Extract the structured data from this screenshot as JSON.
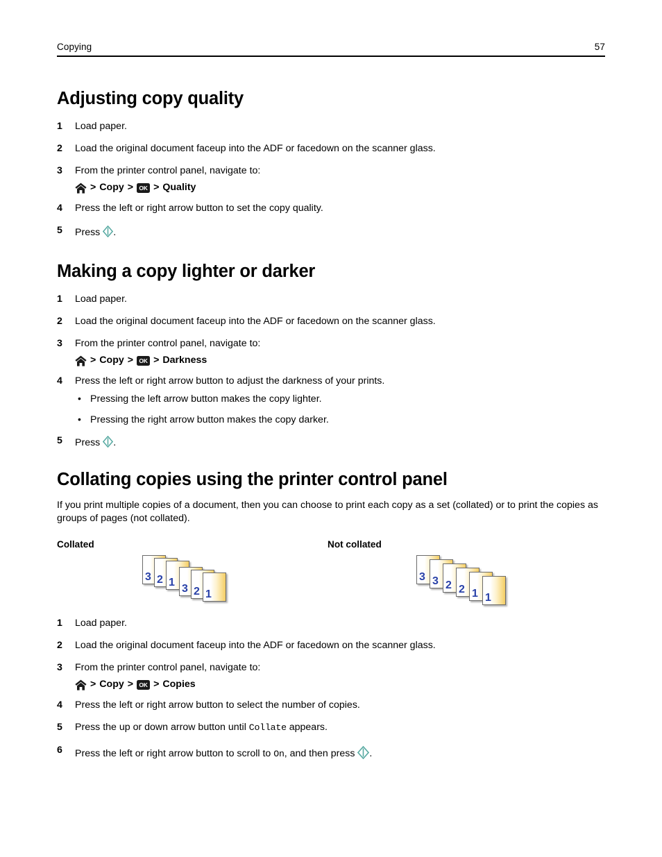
{
  "header": {
    "chapter": "Copying",
    "page_number": "57"
  },
  "icons": {
    "home": "home-icon",
    "ok": "OK",
    "start": "start-icon"
  },
  "sections": [
    {
      "id": "adjusting-copy-quality",
      "heading": "Adjusting copy quality",
      "steps": [
        {
          "num": "1",
          "text": "Load paper."
        },
        {
          "num": "2",
          "text": "Load the original document faceup into the ADF or facedown on the scanner glass."
        },
        {
          "num": "3",
          "text": "From the printer control panel, navigate to:"
        },
        {
          "num": "4",
          "text": "Press the left or right arrow button to set the copy quality."
        },
        {
          "num": "5",
          "text": "Press"
        }
      ],
      "navpath": {
        "sep1": ">",
        "copy": "Copy",
        "sep2": ">",
        "sep3": ">",
        "target": "Quality"
      }
    },
    {
      "id": "making-a-copy-lighter-or-darker",
      "heading": "Making a copy lighter or darker",
      "steps": [
        {
          "num": "1",
          "text": "Load paper."
        },
        {
          "num": "2",
          "text": "Load the original document faceup into the ADF or facedown on the scanner glass."
        },
        {
          "num": "3",
          "text": "From the printer control panel, navigate to:"
        },
        {
          "num": "4",
          "text": "Press the left or right arrow button to adjust the darkness of your prints."
        },
        {
          "num": "5",
          "text": "Press"
        }
      ],
      "navpath": {
        "sep1": ">",
        "copy": "Copy",
        "sep2": ">",
        "sep3": ">",
        "target": "Darkness"
      },
      "bullets": [
        "Pressing the left arrow button makes the copy lighter.",
        "Pressing the right arrow button makes the copy darker."
      ]
    },
    {
      "id": "collating-copies",
      "heading": "Collating copies using the printer control panel",
      "intro": "If you print multiple copies of a document, then you can choose to print each copy as a set (collated) or to print the copies as groups of pages (not collated).",
      "figure": {
        "collated_label": "Collated",
        "not_collated_label": "Not collated",
        "collated_sequence": [
          "3",
          "2",
          "1",
          "3",
          "2",
          "1"
        ],
        "not_collated_sequence": [
          "3",
          "3",
          "2",
          "2",
          "1",
          "1"
        ],
        "sheet_number_color": "#2a42a8",
        "sheet_fill_start": "#ffffff",
        "sheet_fill_end": "#f5ce63"
      },
      "steps": [
        {
          "num": "1",
          "text": "Load paper."
        },
        {
          "num": "2",
          "text": "Load the original document faceup into the ADF or facedown on the scanner glass."
        },
        {
          "num": "3",
          "text": "From the printer control panel, navigate to:"
        },
        {
          "num": "4",
          "text": "Press the left or right arrow button to select the number of copies."
        },
        {
          "num": "5a",
          "text": "Press the up or down arrow button until"
        },
        {
          "num": "5b",
          "text": "appears."
        },
        {
          "num": "6a",
          "text": "Press the left or right arrow button to scroll to"
        },
        {
          "num": "6b",
          "text": ", and then press"
        }
      ],
      "navpath": {
        "sep1": ">",
        "copy": "Copy",
        "sep2": ">",
        "sep3": ">",
        "target": "Copies"
      },
      "mono_terms": {
        "collate": "Collate",
        "on": "On"
      },
      "step_numbers": {
        "five": "5",
        "six": "6"
      }
    }
  ],
  "punctuation": {
    "period": "."
  }
}
